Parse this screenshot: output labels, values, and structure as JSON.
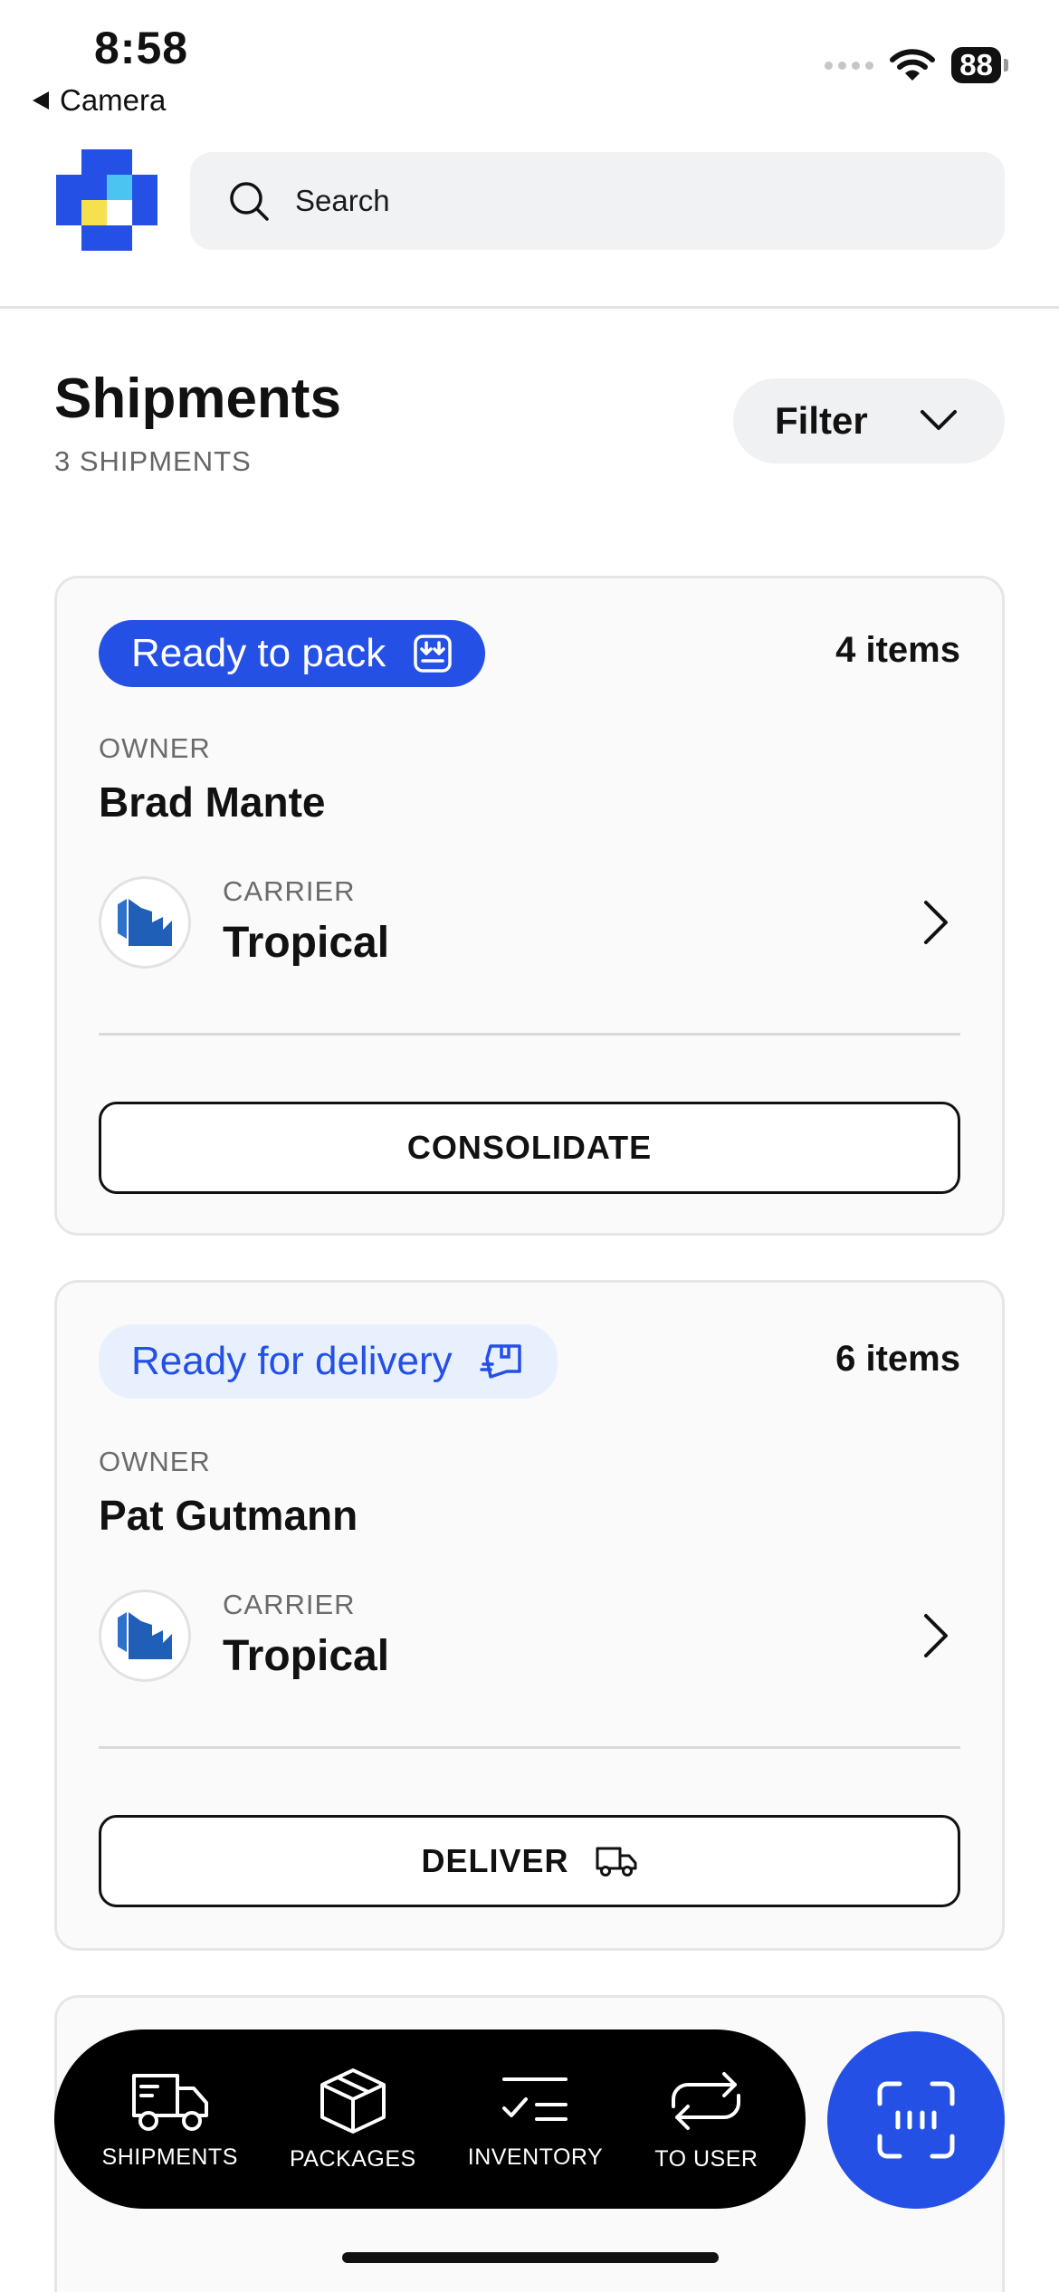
{
  "status_bar": {
    "time": "8:58",
    "back_app": "Camera",
    "battery": "88"
  },
  "header": {
    "search_placeholder": "Search"
  },
  "page": {
    "title": "Shipments",
    "subtitle": "3 SHIPMENTS",
    "filter_label": "Filter"
  },
  "shipments": [
    {
      "status": "Ready to pack",
      "items": "4 items",
      "owner_label": "OWNER",
      "owner": "Brad Mante",
      "carrier_label": "CARRIER",
      "carrier": "Tropical",
      "action": "CONSOLIDATE"
    },
    {
      "status": "Ready for delivery",
      "items": "6 items",
      "owner_label": "OWNER",
      "owner": "Pat Gutmann",
      "carrier_label": "CARRIER",
      "carrier": "Tropical",
      "action": "DELIVER"
    }
  ],
  "bottom_nav": {
    "items": [
      {
        "label": "SHIPMENTS",
        "icon": "truck-icon"
      },
      {
        "label": "PACKAGES",
        "icon": "package-icon"
      },
      {
        "label": "INVENTORY",
        "icon": "checklist-icon"
      },
      {
        "label": "TO USER",
        "icon": "exchange-icon"
      }
    ],
    "fab_icon": "scan-icon"
  },
  "colors": {
    "accent": "#2450e6",
    "badge_soft_bg": "#e9f0fd",
    "nav_bg": "#000000"
  }
}
